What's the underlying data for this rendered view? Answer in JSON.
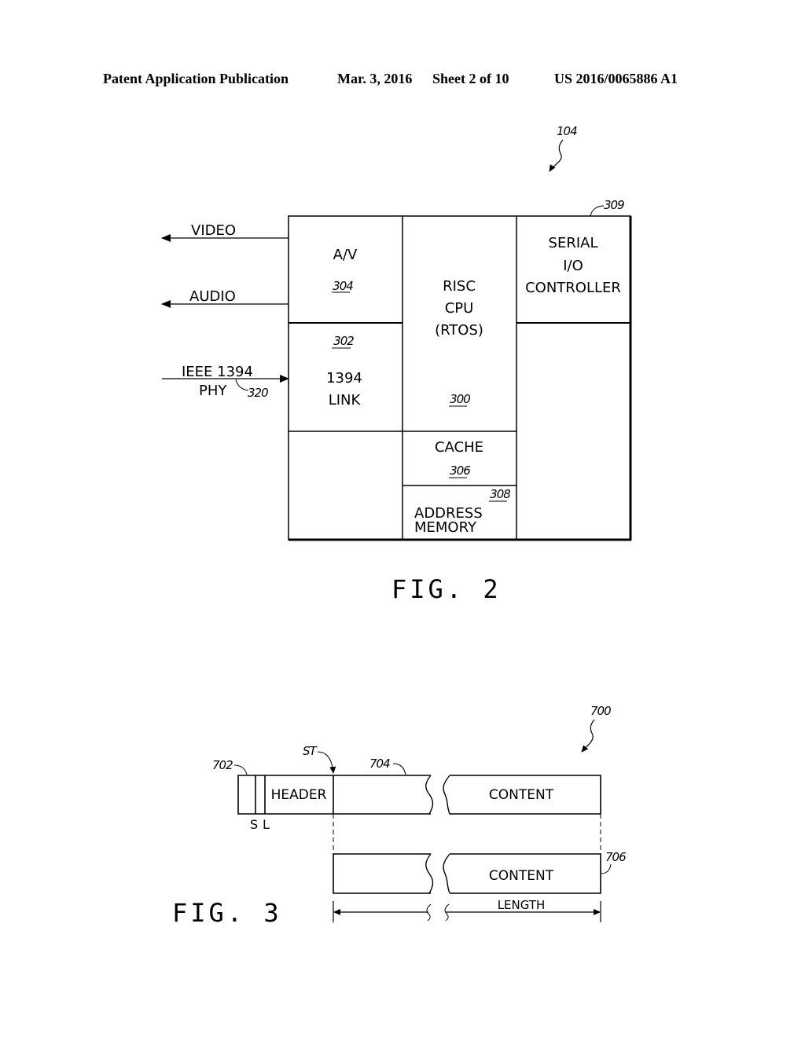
{
  "header": {
    "publication": "Patent Application Publication",
    "date": "Mar. 3, 2016",
    "sheet": "Sheet 2 of 10",
    "number": "US 2016/0065886 A1"
  },
  "fig2": {
    "caption": "FIG. 2",
    "ref_device": "104",
    "signals": {
      "video": "VIDEO",
      "audio": "AUDIO",
      "ieee_line1": "IEEE 1394",
      "ieee_line2": "PHY",
      "ieee_ref": "320"
    },
    "blocks": {
      "av": {
        "label": "A/V",
        "ref": "304"
      },
      "link": {
        "ref": "302",
        "line1": "1394",
        "line2": "LINK"
      },
      "cpu": {
        "line1": "RISC",
        "line2": "CPU",
        "line3": "(RTOS)",
        "ref": "300"
      },
      "serial": {
        "line1": "SERIAL",
        "line2": "I/O",
        "line3": "CONTROLLER",
        "ref": "309"
      },
      "cache": {
        "label": "CACHE",
        "ref": "306"
      },
      "address": {
        "line1": "ADDRESS",
        "line2": "MEMORY",
        "ref": "308"
      }
    }
  },
  "fig3": {
    "caption": "FIG. 3",
    "ref_packet": "700",
    "ref_field": "702",
    "ref_st": "ST",
    "ref_body": "704",
    "ref_content": "706",
    "header_label": "HEADER",
    "s_label": "S",
    "l_label": "L",
    "content_top": "CONTENT",
    "content_bottom": "CONTENT",
    "length_label": "LENGTH"
  }
}
